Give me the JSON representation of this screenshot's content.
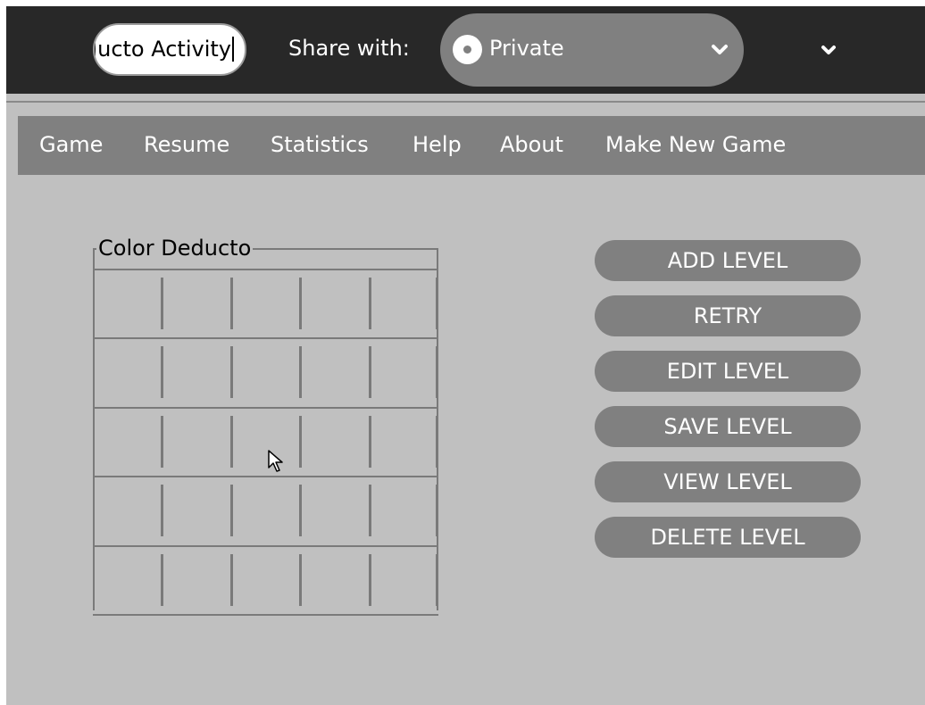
{
  "toolbar": {
    "title_value": "Color Deducto Activity",
    "share_label": "Share with:",
    "share_value": "Private",
    "share_icon": "private-radio-icon",
    "share_arrow_icon": "chevron-down-icon",
    "more_icon": "chevron-down-icon"
  },
  "menu": {
    "items": [
      "Game",
      "Resume",
      "Statistics",
      "Help",
      "About",
      "Make New Game"
    ]
  },
  "board": {
    "legend": "Color Deducto",
    "rows": 5,
    "columns": 5
  },
  "actions": {
    "buttons": [
      "ADD LEVEL",
      "RETRY",
      "EDIT LEVEL",
      "SAVE LEVEL",
      "VIEW LEVEL",
      "DELETE LEVEL"
    ]
  },
  "colors": {
    "toolbar_bg": "#282828",
    "surface": "#c0c0c0",
    "button_bg": "#808080",
    "text_light": "#ffffff"
  }
}
